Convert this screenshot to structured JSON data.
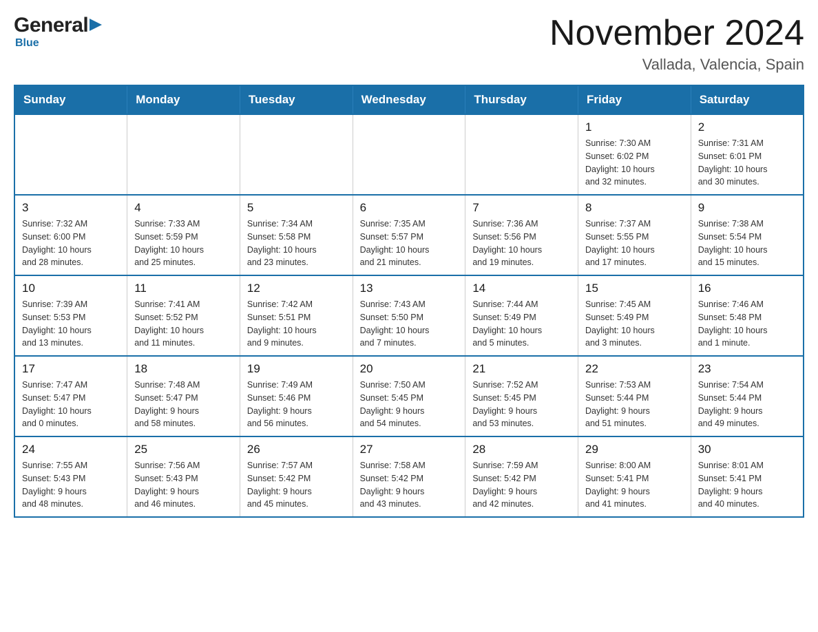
{
  "header": {
    "logo_general": "General",
    "logo_blue": "Blue",
    "title": "November 2024",
    "subtitle": "Vallada, Valencia, Spain"
  },
  "calendar": {
    "days_of_week": [
      "Sunday",
      "Monday",
      "Tuesday",
      "Wednesday",
      "Thursday",
      "Friday",
      "Saturday"
    ],
    "weeks": [
      [
        {
          "day": "",
          "info": ""
        },
        {
          "day": "",
          "info": ""
        },
        {
          "day": "",
          "info": ""
        },
        {
          "day": "",
          "info": ""
        },
        {
          "day": "",
          "info": ""
        },
        {
          "day": "1",
          "info": "Sunrise: 7:30 AM\nSunset: 6:02 PM\nDaylight: 10 hours\nand 32 minutes."
        },
        {
          "day": "2",
          "info": "Sunrise: 7:31 AM\nSunset: 6:01 PM\nDaylight: 10 hours\nand 30 minutes."
        }
      ],
      [
        {
          "day": "3",
          "info": "Sunrise: 7:32 AM\nSunset: 6:00 PM\nDaylight: 10 hours\nand 28 minutes."
        },
        {
          "day": "4",
          "info": "Sunrise: 7:33 AM\nSunset: 5:59 PM\nDaylight: 10 hours\nand 25 minutes."
        },
        {
          "day": "5",
          "info": "Sunrise: 7:34 AM\nSunset: 5:58 PM\nDaylight: 10 hours\nand 23 minutes."
        },
        {
          "day": "6",
          "info": "Sunrise: 7:35 AM\nSunset: 5:57 PM\nDaylight: 10 hours\nand 21 minutes."
        },
        {
          "day": "7",
          "info": "Sunrise: 7:36 AM\nSunset: 5:56 PM\nDaylight: 10 hours\nand 19 minutes."
        },
        {
          "day": "8",
          "info": "Sunrise: 7:37 AM\nSunset: 5:55 PM\nDaylight: 10 hours\nand 17 minutes."
        },
        {
          "day": "9",
          "info": "Sunrise: 7:38 AM\nSunset: 5:54 PM\nDaylight: 10 hours\nand 15 minutes."
        }
      ],
      [
        {
          "day": "10",
          "info": "Sunrise: 7:39 AM\nSunset: 5:53 PM\nDaylight: 10 hours\nand 13 minutes."
        },
        {
          "day": "11",
          "info": "Sunrise: 7:41 AM\nSunset: 5:52 PM\nDaylight: 10 hours\nand 11 minutes."
        },
        {
          "day": "12",
          "info": "Sunrise: 7:42 AM\nSunset: 5:51 PM\nDaylight: 10 hours\nand 9 minutes."
        },
        {
          "day": "13",
          "info": "Sunrise: 7:43 AM\nSunset: 5:50 PM\nDaylight: 10 hours\nand 7 minutes."
        },
        {
          "day": "14",
          "info": "Sunrise: 7:44 AM\nSunset: 5:49 PM\nDaylight: 10 hours\nand 5 minutes."
        },
        {
          "day": "15",
          "info": "Sunrise: 7:45 AM\nSunset: 5:49 PM\nDaylight: 10 hours\nand 3 minutes."
        },
        {
          "day": "16",
          "info": "Sunrise: 7:46 AM\nSunset: 5:48 PM\nDaylight: 10 hours\nand 1 minute."
        }
      ],
      [
        {
          "day": "17",
          "info": "Sunrise: 7:47 AM\nSunset: 5:47 PM\nDaylight: 10 hours\nand 0 minutes."
        },
        {
          "day": "18",
          "info": "Sunrise: 7:48 AM\nSunset: 5:47 PM\nDaylight: 9 hours\nand 58 minutes."
        },
        {
          "day": "19",
          "info": "Sunrise: 7:49 AM\nSunset: 5:46 PM\nDaylight: 9 hours\nand 56 minutes."
        },
        {
          "day": "20",
          "info": "Sunrise: 7:50 AM\nSunset: 5:45 PM\nDaylight: 9 hours\nand 54 minutes."
        },
        {
          "day": "21",
          "info": "Sunrise: 7:52 AM\nSunset: 5:45 PM\nDaylight: 9 hours\nand 53 minutes."
        },
        {
          "day": "22",
          "info": "Sunrise: 7:53 AM\nSunset: 5:44 PM\nDaylight: 9 hours\nand 51 minutes."
        },
        {
          "day": "23",
          "info": "Sunrise: 7:54 AM\nSunset: 5:44 PM\nDaylight: 9 hours\nand 49 minutes."
        }
      ],
      [
        {
          "day": "24",
          "info": "Sunrise: 7:55 AM\nSunset: 5:43 PM\nDaylight: 9 hours\nand 48 minutes."
        },
        {
          "day": "25",
          "info": "Sunrise: 7:56 AM\nSunset: 5:43 PM\nDaylight: 9 hours\nand 46 minutes."
        },
        {
          "day": "26",
          "info": "Sunrise: 7:57 AM\nSunset: 5:42 PM\nDaylight: 9 hours\nand 45 minutes."
        },
        {
          "day": "27",
          "info": "Sunrise: 7:58 AM\nSunset: 5:42 PM\nDaylight: 9 hours\nand 43 minutes."
        },
        {
          "day": "28",
          "info": "Sunrise: 7:59 AM\nSunset: 5:42 PM\nDaylight: 9 hours\nand 42 minutes."
        },
        {
          "day": "29",
          "info": "Sunrise: 8:00 AM\nSunset: 5:41 PM\nDaylight: 9 hours\nand 41 minutes."
        },
        {
          "day": "30",
          "info": "Sunrise: 8:01 AM\nSunset: 5:41 PM\nDaylight: 9 hours\nand 40 minutes."
        }
      ]
    ]
  }
}
